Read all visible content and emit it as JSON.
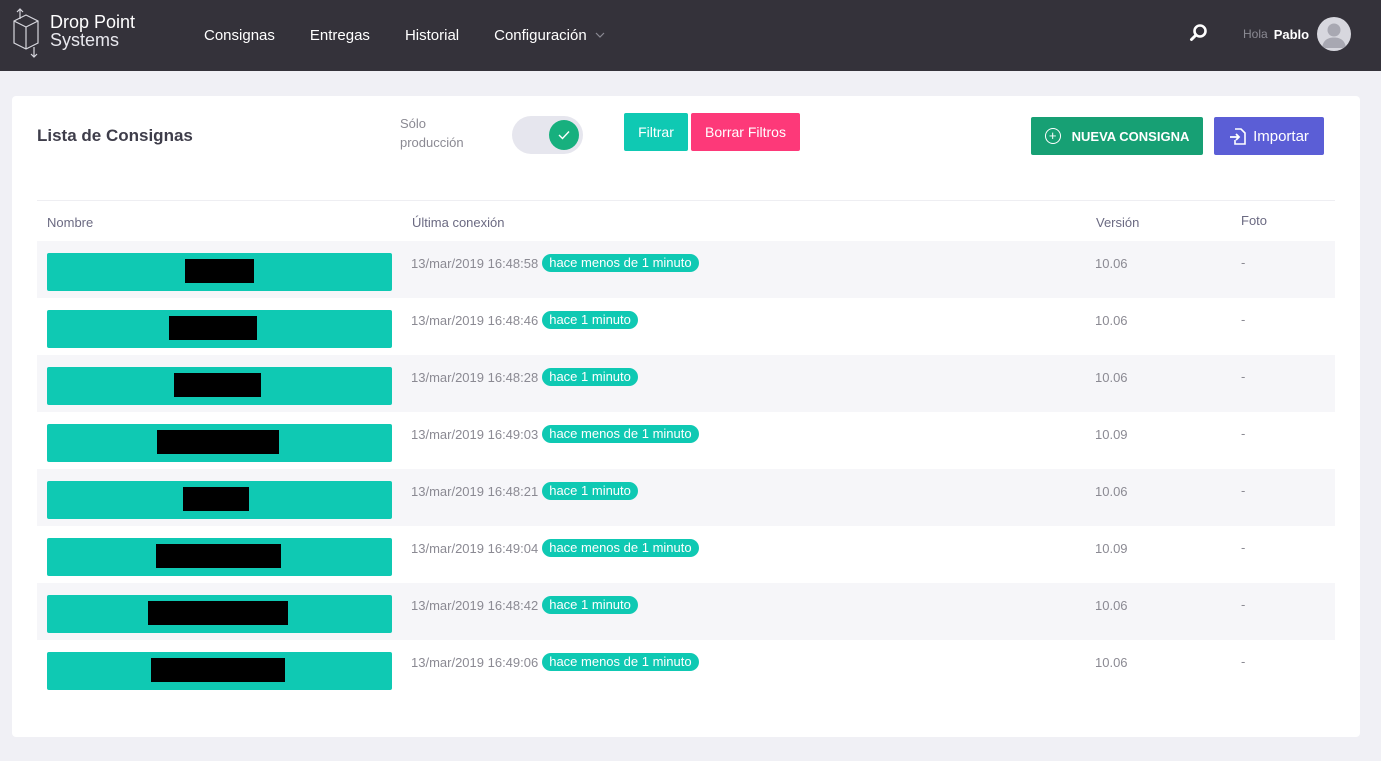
{
  "brand": {
    "line1": "Drop Point",
    "line2": "Systems"
  },
  "nav": {
    "items": [
      {
        "label": "Consignas"
      },
      {
        "label": "Entregas"
      },
      {
        "label": "Historial"
      },
      {
        "label": "Configuración"
      }
    ]
  },
  "user": {
    "greeting": "Hola",
    "name": "Pablo"
  },
  "page": {
    "title": "Lista de Consignas"
  },
  "toolbar": {
    "toggle_label": "Sólo producción",
    "toggle_on": true,
    "filter_label": "Filtrar",
    "clear_label": "Borrar Filtros",
    "new_label": "NUEVA CONSIGNA",
    "import_label": "Importar"
  },
  "table": {
    "headers": {
      "name": "Nombre",
      "last_connection": "Última conexión",
      "version": "Versión",
      "photo": "Foto"
    },
    "rows": [
      {
        "date": "13/mar/2019 16:48:58",
        "ago": "hace menos de 1 minuto",
        "version": "10.06",
        "photo": "-"
      },
      {
        "date": "13/mar/2019 16:48:46",
        "ago": "hace 1 minuto",
        "version": "10.06",
        "photo": "-"
      },
      {
        "date": "13/mar/2019 16:48:28",
        "ago": "hace 1 minuto",
        "version": "10.06",
        "photo": "-"
      },
      {
        "date": "13/mar/2019 16:49:03",
        "ago": "hace menos de 1 minuto",
        "version": "10.09",
        "photo": "-"
      },
      {
        "date": "13/mar/2019 16:48:21",
        "ago": "hace 1 minuto",
        "version": "10.06",
        "photo": "-"
      },
      {
        "date": "13/mar/2019 16:49:04",
        "ago": "hace menos de 1 minuto",
        "version": "10.09",
        "photo": "-"
      },
      {
        "date": "13/mar/2019 16:48:42",
        "ago": "hace 1 minuto",
        "version": "10.06",
        "photo": "-"
      },
      {
        "date": "13/mar/2019 16:49:06",
        "ago": "hace menos de 1 minuto",
        "version": "10.06",
        "photo": "-"
      }
    ]
  },
  "colors": {
    "navbar": "#34323a",
    "teal": "#0fc9b3",
    "pink": "#fd3979",
    "green": "#17a074",
    "indigo": "#5b5ed6"
  },
  "icons": {
    "search": "search-icon",
    "avatar": "user-avatar-icon",
    "import": "import-icon",
    "plus": "plus-circle-icon",
    "check": "check-icon",
    "chevron": "chevron-down-icon"
  }
}
